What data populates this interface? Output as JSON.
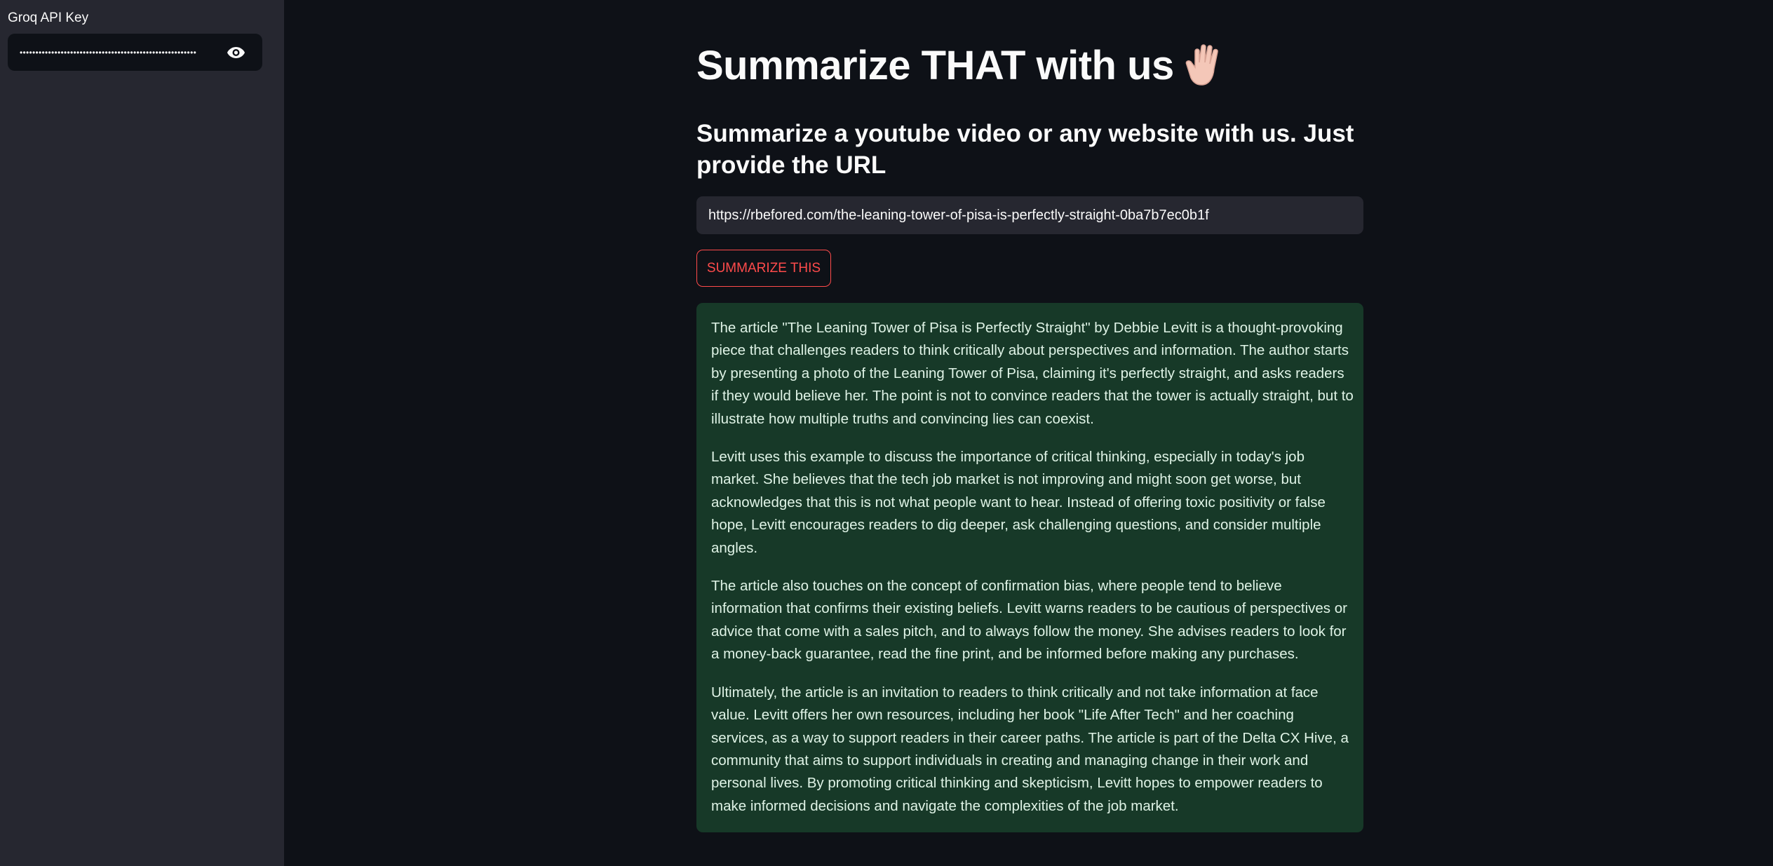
{
  "sidebar": {
    "api_key_label": "Groq API Key",
    "api_key_masked": "••••••••••••••••••••••••••••••••••••••••••••••••••••••••",
    "reveal_icon": "eye-icon"
  },
  "main": {
    "title": "Summarize THAT with us",
    "title_emoji": "vulcan-salute-hand",
    "subtitle": "Summarize a youtube video or any website with us. Just provide the URL",
    "url_value": "https://rbefored.com/the-leaning-tower-of-pisa-is-perfectly-straight-0ba7b7ec0b1f",
    "button_label": "SUMMARIZE THIS",
    "summary": [
      "The article \"The Leaning Tower of Pisa is Perfectly Straight\" by Debbie Levitt is a thought-provoking piece that challenges readers to think critically about perspectives and information. The author starts by presenting a photo of the Leaning Tower of Pisa, claiming it's perfectly straight, and asks readers if they would believe her. The point is not to convince readers that the tower is actually straight, but to illustrate how multiple truths and convincing lies can coexist.",
      "Levitt uses this example to discuss the importance of critical thinking, especially in today's job market. She believes that the tech job market is not improving and might soon get worse, but acknowledges that this is not what people want to hear. Instead of offering toxic positivity or false hope, Levitt encourages readers to dig deeper, ask challenging questions, and consider multiple angles.",
      "The article also touches on the concept of confirmation bias, where people tend to believe information that confirms their existing beliefs. Levitt warns readers to be cautious of perspectives or advice that come with a sales pitch, and to always follow the money. She advises readers to look for a money-back guarantee, read the fine print, and be informed before making any purchases.",
      "Ultimately, the article is an invitation to readers to think critically and not take information at face value. Levitt offers her own resources, including her book \"Life After Tech\" and her coaching services, as a way to support readers in their career paths. The article is part of the Delta CX Hive, a community that aims to support individuals in creating and managing change in their work and personal lives. By promoting critical thinking and skepticism, Levitt hopes to empower readers to make informed decisions and navigate the complexities of the job market."
    ]
  },
  "colors": {
    "background": "#0e1117",
    "sidebar": "#262730",
    "accent": "#ff4b4b",
    "success_bg": "#173928",
    "success_text": "#dff3e6"
  }
}
